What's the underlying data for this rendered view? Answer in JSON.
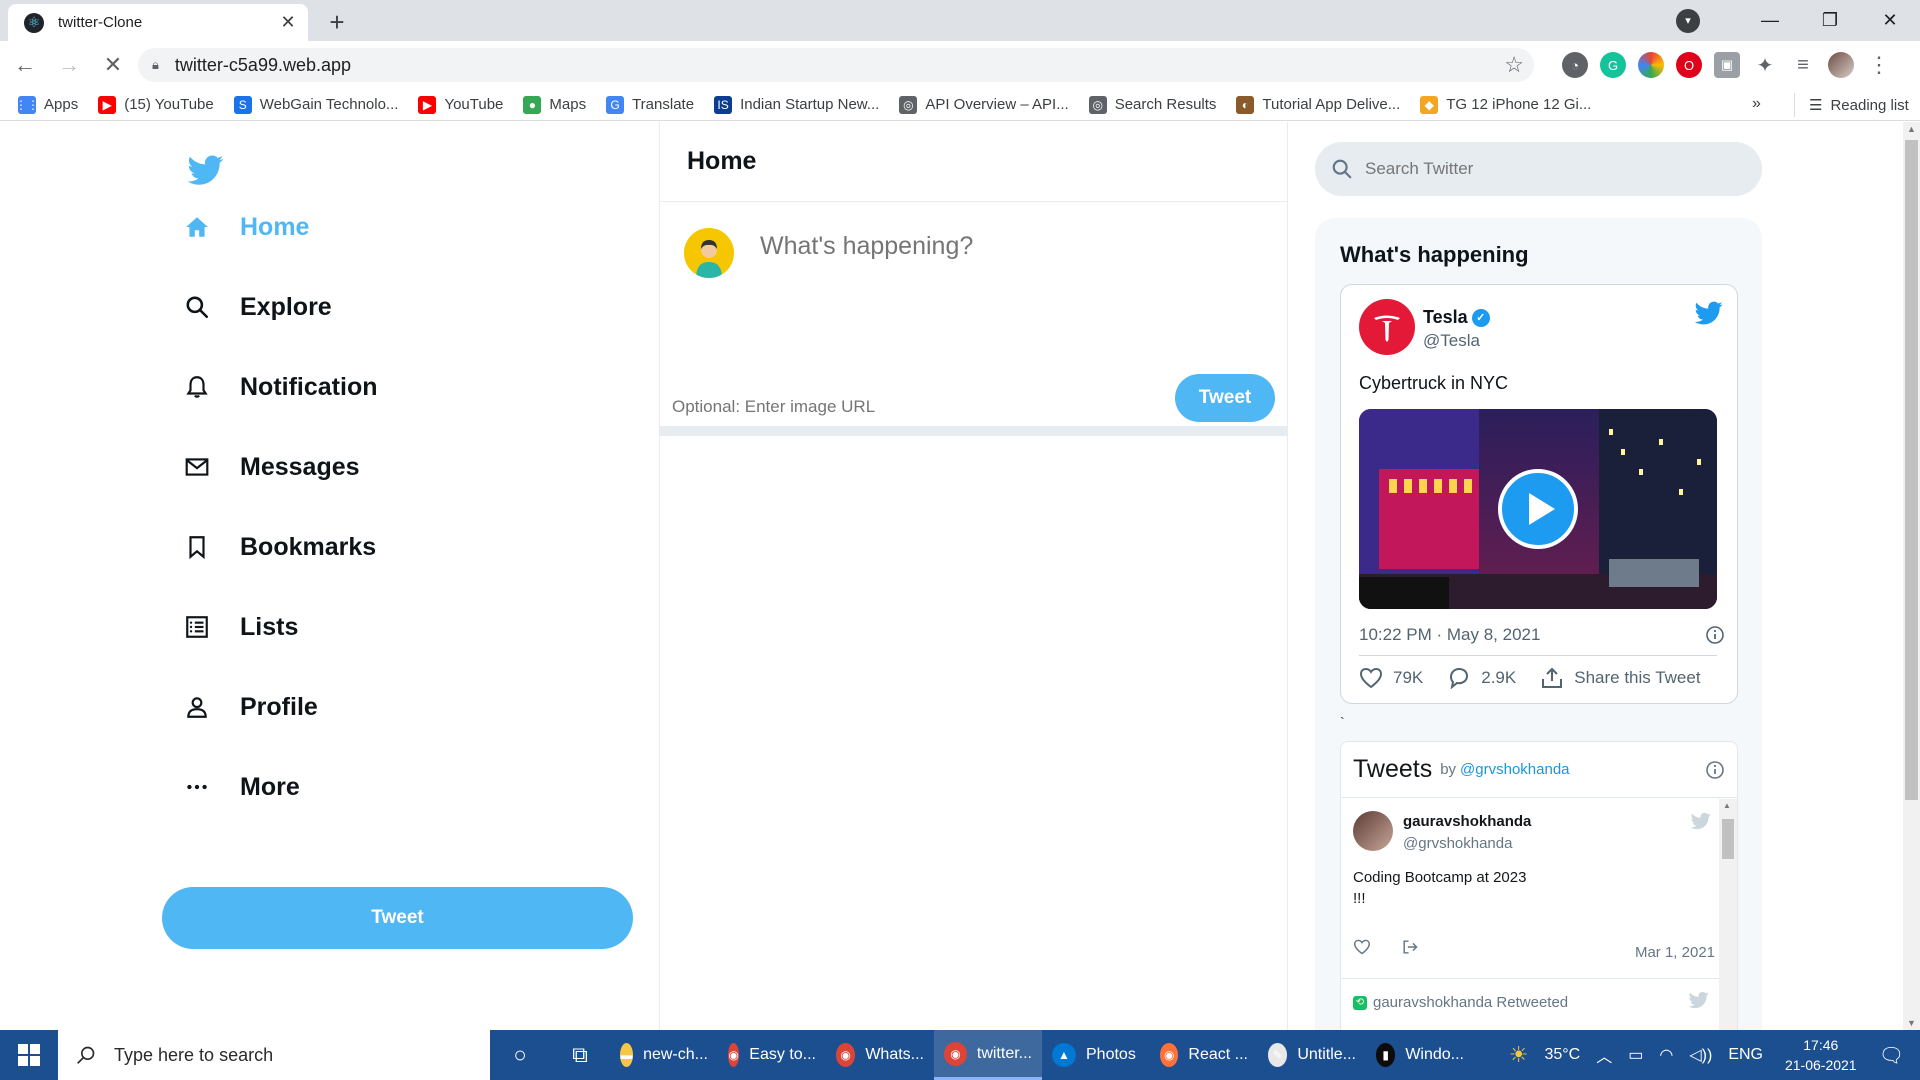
{
  "browser": {
    "tab_title": "twitter-Clone",
    "url": "twitter-c5a99.web.app",
    "bookmarks": [
      {
        "label": "Apps",
        "icon": "apps-grid-icon",
        "color": "#4285f4"
      },
      {
        "label": "(15) YouTube",
        "icon": "youtube-icon",
        "color": "#ff0000"
      },
      {
        "label": "WebGain Technolo...",
        "icon": "webgain-icon",
        "color": "#1a73e8"
      },
      {
        "label": "YouTube",
        "icon": "youtube-icon",
        "color": "#ff0000"
      },
      {
        "label": "Maps",
        "icon": "maps-pin-icon",
        "color": "#34a853"
      },
      {
        "label": "Translate",
        "icon": "translate-icon",
        "color": "#4285f4"
      },
      {
        "label": "Indian Startup New...",
        "icon": "isn-icon",
        "color": "#0b3e91"
      },
      {
        "label": "API Overview – API...",
        "icon": "globe-icon",
        "color": "#5f6368"
      },
      {
        "label": "Search Results",
        "icon": "globe-icon",
        "color": "#5f6368"
      },
      {
        "label": "Tutorial App Delive...",
        "icon": "tutorial-icon",
        "color": "#8a5a2b"
      },
      {
        "label": "TG 12 iPhone 12 Gi...",
        "icon": "tg-icon",
        "color": "#f4a623"
      }
    ],
    "bookmarks_more": "»",
    "reading_list": "Reading list"
  },
  "sidebar": {
    "items": [
      {
        "label": "Home",
        "icon": "home-icon",
        "active": true
      },
      {
        "label": "Explore",
        "icon": "search-icon"
      },
      {
        "label": "Notification",
        "icon": "bell-icon"
      },
      {
        "label": "Messages",
        "icon": "mail-icon"
      },
      {
        "label": "Bookmarks",
        "icon": "bookmark-icon"
      },
      {
        "label": "Lists",
        "icon": "list-icon"
      },
      {
        "label": "Profile",
        "icon": "person-icon"
      },
      {
        "label": "More",
        "icon": "more-icon"
      }
    ],
    "tweet_button": "Tweet"
  },
  "feed": {
    "title": "Home",
    "input_placeholder": "What's happening?",
    "image_placeholder": "Optional: Enter image URL",
    "tweet_button": "Tweet"
  },
  "widgets": {
    "search_placeholder": "Search Twitter",
    "happening_title": "What's happening",
    "embed": {
      "name": "Tesla",
      "handle": "@Tesla",
      "text": "Cybertruck in NYC",
      "time": "10:22 PM · May 8, 2021",
      "likes": "79K",
      "replies": "2.9K",
      "share": "Share this Tweet"
    },
    "stray_char": "`",
    "timeline": {
      "title": "Tweets",
      "by": "by",
      "handle": "@grvshokhanda",
      "tweet": {
        "name": "gauravshokhanda",
        "handle": "@grvshokhanda",
        "text_line1": "Coding Bootcamp at 2023",
        "text_line2": "!!!",
        "date": "Mar 1, 2021"
      },
      "retweet_label": "gauravshokhanda Retweeted"
    }
  },
  "taskbar": {
    "search_placeholder": "Type here to search",
    "apps": [
      {
        "label": "new-ch...",
        "icon": "folder-icon",
        "color": "#f6c744"
      },
      {
        "label": "Easy to...",
        "icon": "chrome-icon",
        "color": "#db4437"
      },
      {
        "label": "Whats...",
        "icon": "chrome-icon",
        "color": "#db4437"
      },
      {
        "label": "twitter...",
        "icon": "chrome-icon",
        "color": "#db4437",
        "active": true
      },
      {
        "label": "Photos",
        "icon": "photos-icon",
        "color": "#0078d4"
      },
      {
        "label": "React ...",
        "icon": "firefox-icon",
        "color": "#ff7139"
      },
      {
        "label": "Untitle...",
        "icon": "paint-icon",
        "color": "#e8e8e8"
      },
      {
        "label": "Windo...",
        "icon": "terminal-icon",
        "color": "#0c0c0c"
      }
    ],
    "weather": "35°C",
    "language": "ENG",
    "time": "17:46",
    "date": "21-06-2021"
  },
  "colors": {
    "twitter_blue": "#50b7f5",
    "tesla_red": "#e31937",
    "taskbar": "#1c4f8f"
  }
}
